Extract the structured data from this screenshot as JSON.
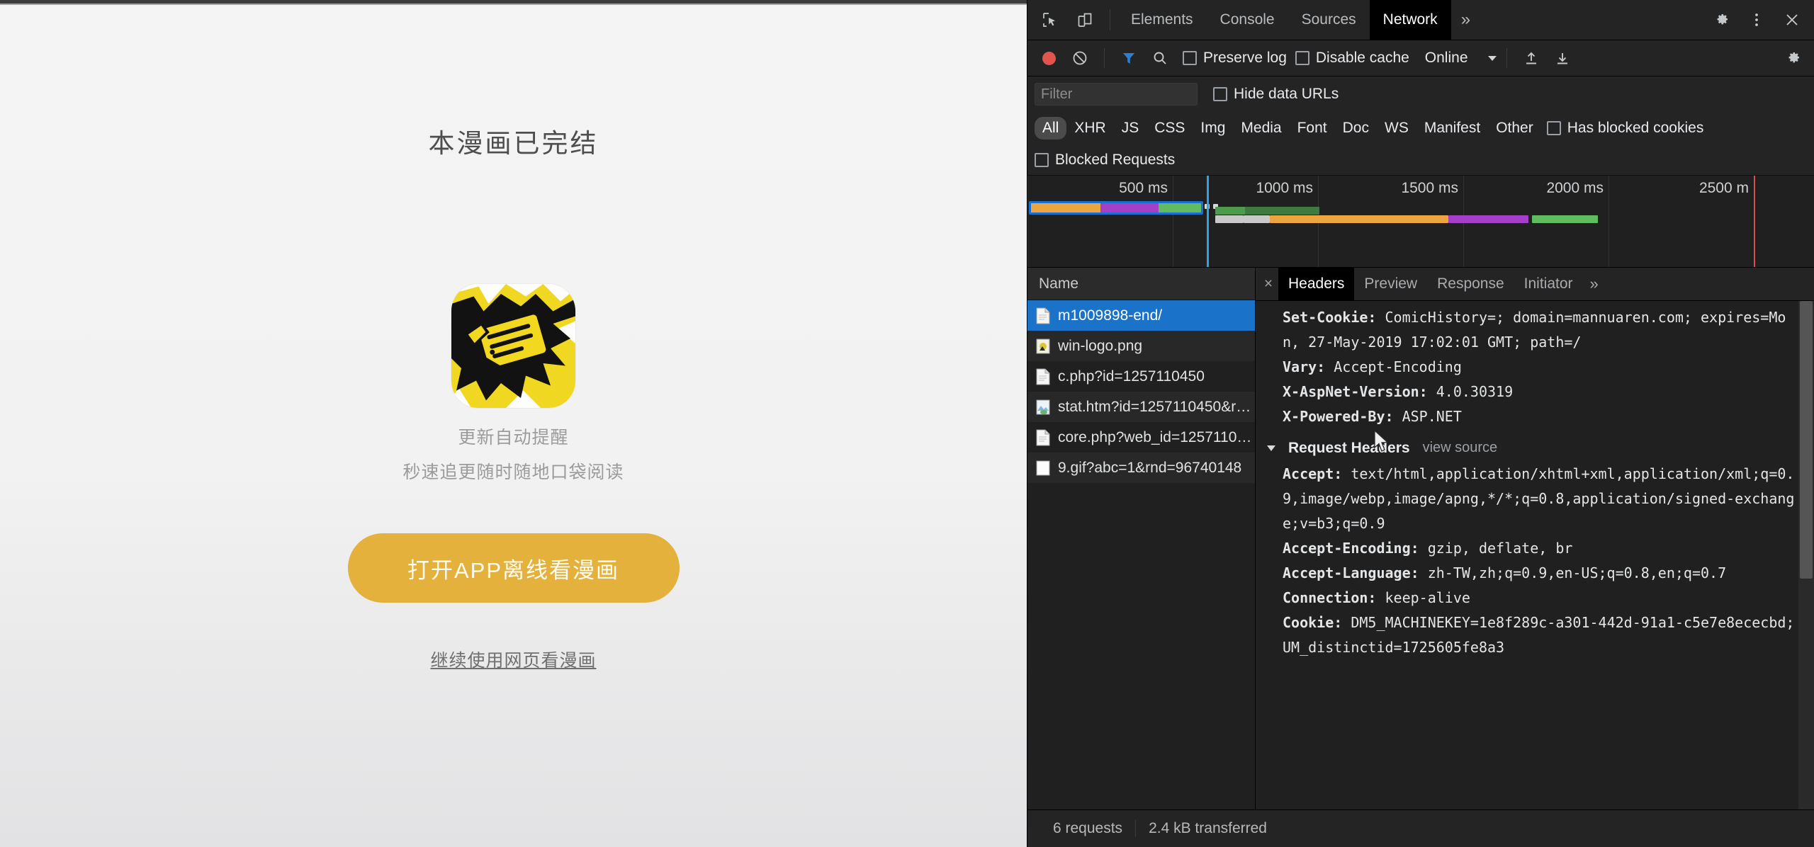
{
  "webpage": {
    "title": "本漫画已完结",
    "logo_alt": "comic-app-logo",
    "promo_line_1": "更新自动提醒",
    "promo_line_2": "秒速追更随时随地口袋阅读",
    "cta_label": "打开APP离线看漫画",
    "alt_link_label": "继续使用网页看漫画",
    "colors": {
      "cta_bg": "#e3b13c",
      "cta_text": "#fffdf3",
      "page_bg": "#f2f2f2",
      "title_text": "#4e4e4e"
    }
  },
  "devtools": {
    "tabs": [
      {
        "label": "Elements",
        "active": false
      },
      {
        "label": "Console",
        "active": false
      },
      {
        "label": "Sources",
        "active": false
      },
      {
        "label": "Network",
        "active": true
      }
    ],
    "more_tabs_label": "»",
    "icons": {
      "inspect": "inspect-element-icon",
      "device": "device-toolbar-icon",
      "settings": "gear-icon",
      "kebab": "more-options-icon",
      "close": "close-icon"
    },
    "network_toolbar": {
      "record_label": "record-button",
      "clear_label": "clear-button",
      "filter_toggle_label": "filter-icon",
      "search_label": "search-icon",
      "preserve_log": {
        "label": "Preserve log",
        "checked": false
      },
      "disable_cache": {
        "label": "Disable cache",
        "checked": false
      },
      "throttling_value": "Online",
      "import_label": "import-har-icon",
      "export_label": "export-har-icon",
      "settings_label": "network-settings-icon"
    },
    "filter_bar": {
      "placeholder": "Filter",
      "value": "",
      "hide_data_urls": {
        "label": "Hide data URLs",
        "checked": false
      }
    },
    "type_filters": [
      {
        "label": "All",
        "active": true
      },
      {
        "label": "XHR",
        "active": false
      },
      {
        "label": "JS",
        "active": false
      },
      {
        "label": "CSS",
        "active": false
      },
      {
        "label": "Img",
        "active": false
      },
      {
        "label": "Media",
        "active": false
      },
      {
        "label": "Font",
        "active": false
      },
      {
        "label": "Doc",
        "active": false
      },
      {
        "label": "WS",
        "active": false
      },
      {
        "label": "Manifest",
        "active": false
      },
      {
        "label": "Other",
        "active": false
      }
    ],
    "has_blocked_cookies": {
      "label": "Has blocked cookies",
      "checked": false
    },
    "blocked_requests": {
      "label": "Blocked Requests",
      "checked": false
    },
    "overview": {
      "ticks": [
        "500 ms",
        "1000 ms",
        "1500 ms",
        "2000 ms",
        "2500 m"
      ],
      "dclc_marker_color": "#2aa3e8",
      "load_marker_color": "#d75050"
    },
    "request_table": {
      "column_header": "Name",
      "rows": [
        {
          "name": "m1009898-end/",
          "icon": "document-icon",
          "selected": true
        },
        {
          "name": "win-logo.png",
          "icon": "image-icon",
          "selected": false
        },
        {
          "name": "c.php?id=1257110450",
          "icon": "document-icon",
          "selected": false
        },
        {
          "name": "stat.htm?id=1257110450&r=...",
          "icon": "image-icon",
          "selected": false
        },
        {
          "name": "core.php?web_id=12571104...",
          "icon": "document-icon",
          "selected": false
        },
        {
          "name": "9.gif?abc=1&rnd=96740148",
          "icon": "plain-icon",
          "selected": false
        }
      ]
    },
    "detail": {
      "close_label": "×",
      "tabs": [
        {
          "label": "Headers",
          "active": true
        },
        {
          "label": "Preview",
          "active": false
        },
        {
          "label": "Response",
          "active": false
        },
        {
          "label": "Initiator",
          "active": false
        }
      ],
      "more_label": "»",
      "response_headers_visible": [
        {
          "key": "Set-Cookie:",
          "value": " ComicHistory=; domain=mannuaren.com; expires=Mon, 27-May-2019 17:02:01 GMT; path=/"
        },
        {
          "key": "Vary:",
          "value": " Accept-Encoding"
        },
        {
          "key": "X-AspNet-Version:",
          "value": " 4.0.30319"
        },
        {
          "key": "X-Powered-By:",
          "value": " ASP.NET"
        }
      ],
      "request_headers_section": {
        "title": "Request Headers",
        "view_source_label": "view source",
        "items": [
          {
            "key": "Accept:",
            "value": " text/html,application/xhtml+xml,application/xml;q=0.9,image/webp,image/apng,*/*;q=0.8,application/signed-exchange;v=b3;q=0.9"
          },
          {
            "key": "Accept-Encoding:",
            "value": " gzip, deflate, br"
          },
          {
            "key": "Accept-Language:",
            "value": " zh-TW,zh;q=0.9,en-US;q=0.8,en;q=0.7"
          },
          {
            "key": "Connection:",
            "value": " keep-alive"
          },
          {
            "key": "Cookie:",
            "value": " DM5_MACHINEKEY=1e8f289c-a301-442d-91a1-c5e7e8ececbd; UM_distinctid=1725605fe8a3"
          }
        ]
      }
    },
    "status_bar": {
      "requests": "6 requests",
      "transferred": "2.4 kB transferred"
    }
  }
}
